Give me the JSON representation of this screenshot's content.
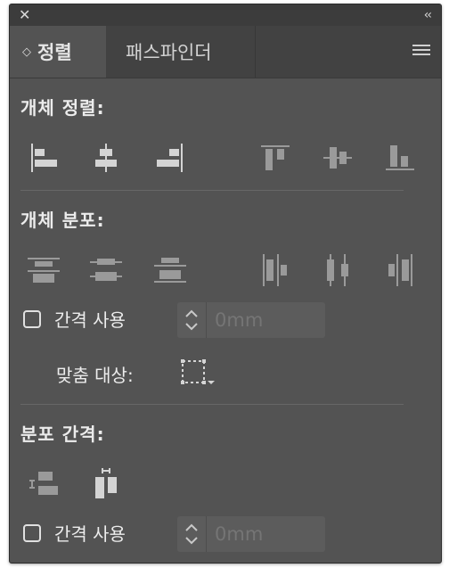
{
  "titlebar": {
    "close_icon": "close-icon",
    "collapse_icon": "double-chevron-left-icon"
  },
  "tabs": [
    {
      "label": "정렬",
      "active": true
    },
    {
      "label": "패스파인더",
      "active": false
    }
  ],
  "panel_menu_icon": "hamburger-menu-icon",
  "align_objects": {
    "title": "개체 정렬:",
    "buttons": [
      "horizontal-align-left",
      "horizontal-align-center",
      "horizontal-align-right",
      "vertical-align-top",
      "vertical-align-center",
      "vertical-align-bottom"
    ]
  },
  "distribute_objects": {
    "title": "개체 분포:",
    "buttons": [
      "vertical-distribute-top",
      "vertical-distribute-center",
      "vertical-distribute-bottom",
      "horizontal-distribute-left",
      "horizontal-distribute-center",
      "horizontal-distribute-right"
    ],
    "use_spacing": {
      "label": "간격 사용",
      "checked": false,
      "placeholder": "0mm"
    },
    "align_to": {
      "label": "맞춤 대상:",
      "icon": "align-to-selection-icon"
    }
  },
  "distribute_spacing": {
    "title": "분포 간격:",
    "buttons": [
      "vertical-distribute-space",
      "horizontal-distribute-space"
    ],
    "use_spacing": {
      "label": "간격 사용",
      "checked": false,
      "placeholder": "0mm"
    }
  },
  "colors": {
    "panel_bg": "#535353",
    "tabbar_bg": "#424242",
    "titlebar_bg": "#3c3c3c",
    "icon_active": "#d4d4d4",
    "icon_dim": "#9a9a9a",
    "text": "#ececec"
  }
}
